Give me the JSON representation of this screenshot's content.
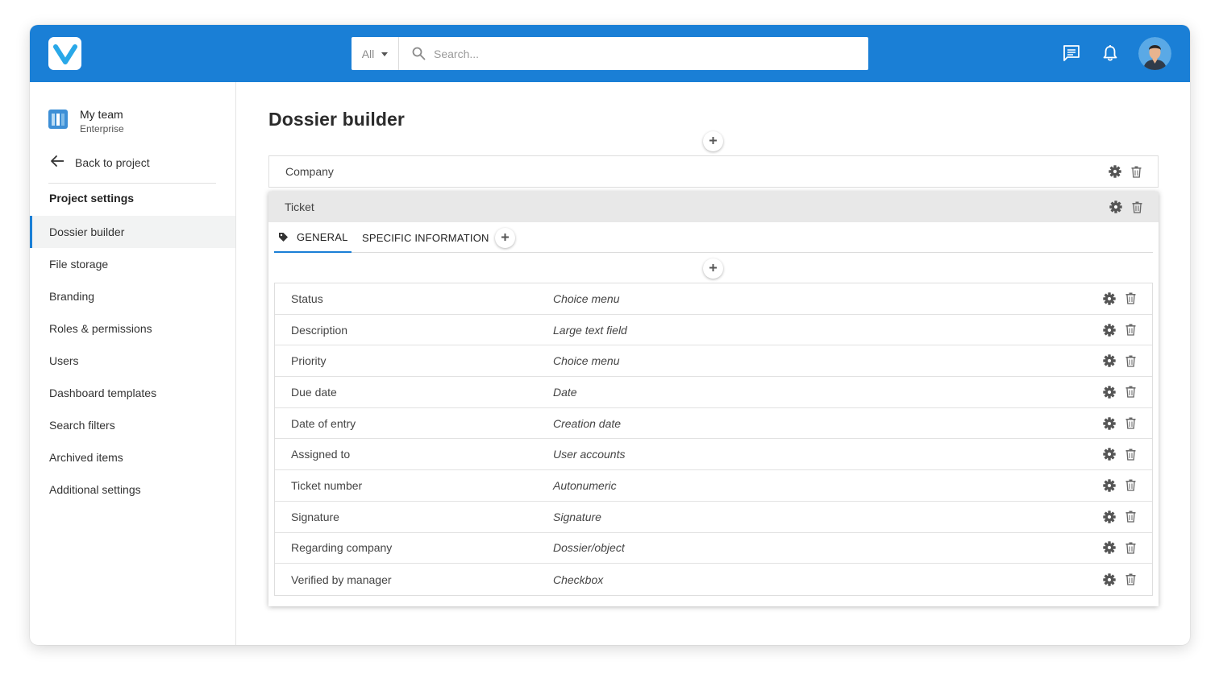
{
  "header": {
    "logo_icon": "v-logo-icon",
    "search_scope": "All",
    "search_placeholder": "Search...",
    "accent_color": "#1a7fd6"
  },
  "sidebar": {
    "team_name": "My team",
    "team_plan": "Enterprise",
    "back_label": "Back to project",
    "section_title": "Project settings",
    "items": [
      {
        "label": "Dossier builder",
        "active": true
      },
      {
        "label": "File storage"
      },
      {
        "label": "Branding"
      },
      {
        "label": "Roles & permissions"
      },
      {
        "label": "Users"
      },
      {
        "label": "Dashboard templates"
      },
      {
        "label": "Search filters"
      },
      {
        "label": "Archived items"
      },
      {
        "label": "Additional settings"
      }
    ]
  },
  "main": {
    "title": "Dossier builder",
    "company_label": "Company",
    "ticket_label": "Ticket",
    "tabs": [
      {
        "label": "GENERAL",
        "active": true
      },
      {
        "label": "SPECIFIC INFORMATION"
      }
    ],
    "fields": [
      {
        "name": "Status",
        "type": "Choice menu"
      },
      {
        "name": "Description",
        "type": "Large text field"
      },
      {
        "name": "Priority",
        "type": "Choice menu"
      },
      {
        "name": "Due date",
        "type": "Date"
      },
      {
        "name": "Date of entry",
        "type": "Creation date"
      },
      {
        "name": "Assigned to",
        "type": "User accounts"
      },
      {
        "name": "Ticket number",
        "type": "Autonumeric"
      },
      {
        "name": "Signature",
        "type": "Signature"
      },
      {
        "name": "Regarding company",
        "type": "Dossier/object"
      },
      {
        "name": "Verified by manager",
        "type": "Checkbox"
      }
    ]
  }
}
